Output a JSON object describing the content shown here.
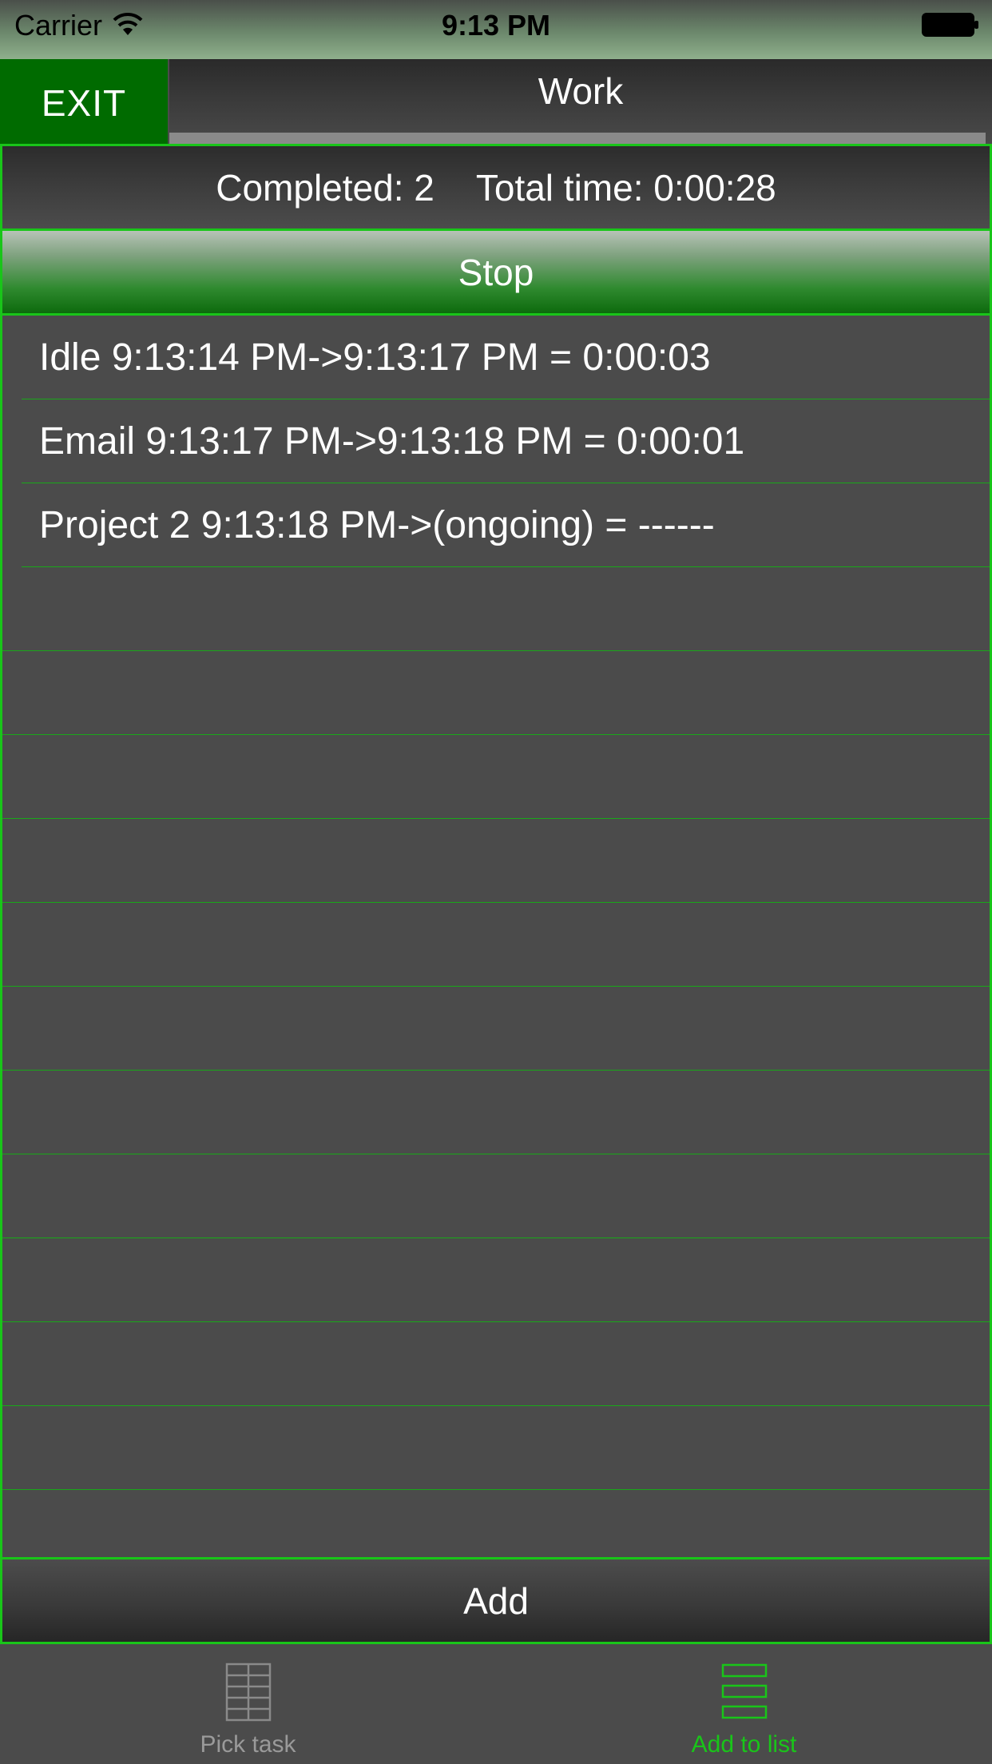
{
  "status_bar": {
    "carrier": "Carrier",
    "time": "9:13 PM",
    "icons": [
      "wifi-icon",
      "battery-icon"
    ]
  },
  "header": {
    "exit_label": "EXIT",
    "title": "Work"
  },
  "summary": {
    "completed": "Completed: 2",
    "total_time": "Total time: 0:00:28"
  },
  "stop_label": "Stop",
  "tasks": [
    "Idle 9:13:14 PM->9:13:17 PM = 0:00:03",
    "Email 9:13:17 PM->9:13:18 PM = 0:00:01",
    "Project 2 9:13:18 PM->(ongoing) = ------"
  ],
  "add_label": "Add",
  "tab_bar": {
    "tabs": [
      {
        "label": "Pick task",
        "icon": "grid-icon",
        "selected": false
      },
      {
        "label": "Add to list",
        "icon": "list-icon",
        "selected": true
      }
    ]
  },
  "colors": {
    "accent": "#19c519",
    "exit_bg": "#006b00",
    "background": "#4b4b4b"
  }
}
